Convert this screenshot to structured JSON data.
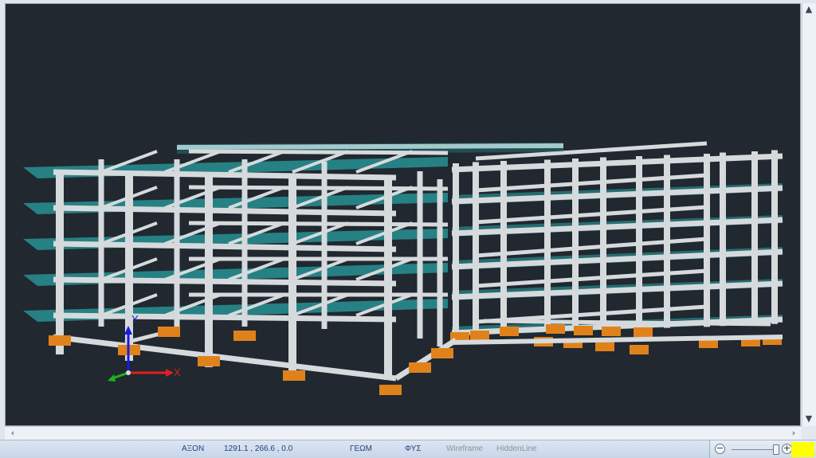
{
  "viewport": {
    "background_color": "#212830",
    "column_color": "#d6dadc",
    "slab_color": "#2aa6a8",
    "footing_color": "#e0821c"
  },
  "axes": {
    "x_label": "X",
    "y_label": "Y",
    "x_color": "#e02020",
    "y_color": "#1a1ae0",
    "z_color": "#19b519"
  },
  "scrollbars": {
    "up_arrow": "▲",
    "down_arrow": "▼",
    "left_arrow": "‹",
    "right_arrow": "›"
  },
  "statusbar": {
    "axis_label": "ΑΞΟΝ",
    "coordinates": "1291.1 , 266.6 , 0.0",
    "geom_label": "ΓΕΩΜ",
    "phys_label": "ΦΥΣ",
    "wireframe_label": "Wireframe",
    "hiddenline_label": "HiddenLine"
  },
  "zoom": {
    "minus": "−",
    "plus": "+",
    "level_fraction": 0.8,
    "indicator_color": "#ffff00"
  }
}
